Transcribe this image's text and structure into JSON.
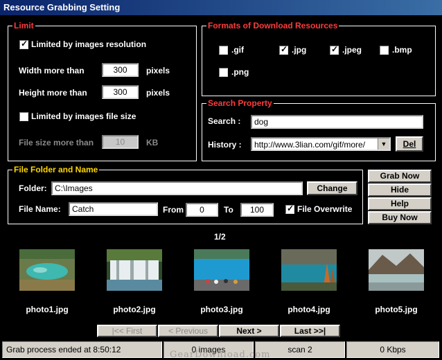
{
  "window": {
    "title": "Resource Grabbing Setting"
  },
  "limit": {
    "legend": "Limit",
    "resolution_label": "Limited by images resolution",
    "resolution_checked": true,
    "width_label": "Width more than",
    "width_value": "300",
    "width_unit": "pixels",
    "height_label": "Height more than",
    "height_value": "300",
    "height_unit": "pixels",
    "filesize_label": "Limited by images file size",
    "filesize_checked": false,
    "filesize_more_label": "File size more than",
    "filesize_value": "10",
    "filesize_unit": "KB"
  },
  "formats": {
    "legend": "Formats of Download Resources",
    "items": [
      {
        "label": ".gif",
        "checked": false
      },
      {
        "label": ".jpg",
        "checked": true
      },
      {
        "label": ".jpeg",
        "checked": true
      },
      {
        "label": ".bmp",
        "checked": false
      },
      {
        "label": ".png",
        "checked": false
      }
    ]
  },
  "search": {
    "legend": "Search Property",
    "search_label": "Search :",
    "search_value": "dog",
    "history_label": "History :",
    "history_value": "http://www.3lian.com/gif/more/",
    "del_label": "Del"
  },
  "folder": {
    "legend": "File Folder and Name",
    "folder_label": "Folder:",
    "folder_value": "C:\\Images",
    "change_label": "Change",
    "filename_label": "File Name:",
    "filename_value": "Catch",
    "from_label": "From",
    "from_value": "0",
    "to_label": "To",
    "to_value": "100",
    "overwrite_label": "File Overwrite",
    "overwrite_checked": true
  },
  "actions": {
    "grab_now": "Grab Now",
    "hide": "Hide",
    "help": "Help",
    "buy_now": "Buy Now"
  },
  "gallery": {
    "page_indicator": "1/2",
    "photos": [
      {
        "name": "photo1.jpg"
      },
      {
        "name": "photo2.jpg"
      },
      {
        "name": "photo3.jpg"
      },
      {
        "name": "photo4.jpg"
      },
      {
        "name": "photo5.jpg"
      }
    ]
  },
  "pager": {
    "first": "|<<  First",
    "previous": "< Previous",
    "next": "Next >",
    "last": "Last  >>|"
  },
  "statusbar": {
    "message": "Grab process ended at 8:50:12",
    "images": "0 images",
    "scan": "scan 2",
    "speed": "0 Kbps"
  },
  "watermark": "GearDownload.com"
}
